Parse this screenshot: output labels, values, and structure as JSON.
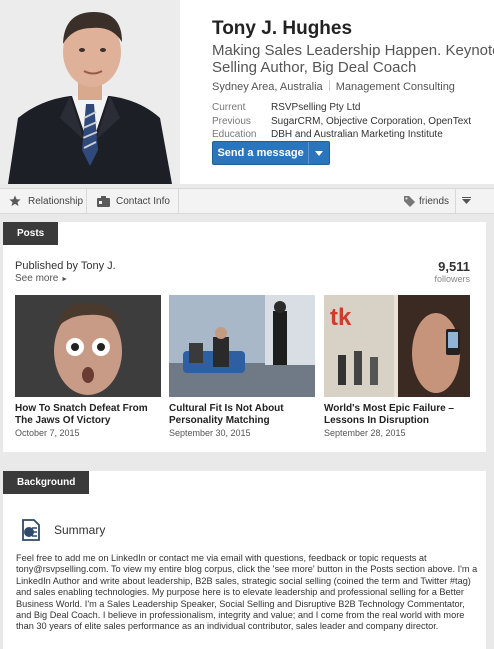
{
  "profile": {
    "name": "Tony J. Hughes",
    "headline_line1": "Making Sales Leadership Happen. Keynote Speaker,",
    "headline_line2": "Selling Author, Big Deal Coach",
    "location": "Sydney Area, Australia",
    "industry": "Management Consulting",
    "current_label": "Current",
    "current_value": "RSVPselling Pty Ltd",
    "previous_label": "Previous",
    "previous_value": "SugarCRM, Objective Corporation, OpenText",
    "education_label": "Education",
    "education_value": "DBH and Australian Marketing Institute",
    "message_button": "Send a message"
  },
  "relationship_bar": {
    "relationship_label": "Relationship",
    "contact_label": "Contact Info",
    "friends_label": "friends"
  },
  "posts": {
    "section_label": "Posts",
    "published_by": "Published by Tony J.",
    "see_more": "See more",
    "followers_count": "9,511",
    "followers_label": "followers",
    "items": [
      {
        "title": "How To Snatch Defeat From The Jaws Of Victory",
        "date": "October 7, 2015"
      },
      {
        "title": "Cultural Fit Is Not About Personality Matching",
        "date": "September 30, 2015"
      },
      {
        "title": "World's Most Epic Failure – Lessons In Disruption",
        "date": "September 28, 2015"
      }
    ]
  },
  "background": {
    "section_label": "Background",
    "summary_title": "Summary",
    "summary_text": "Feel free to add me on LinkedIn or contact me via email with questions, feedback or topic requests at tony@rsvpselling.com. To view my entire blog corpus, click the 'see more' button in the Posts section above. I'm a LinkedIn Author and write about leadership, B2B sales, strategic social selling (coined the term and Twitter #tag) and sales enabling technologies. My purpose here is to elevate leadership and professional selling for a Better Business World. I'm a Sales Leadership Speaker, Social Selling and Disruptive B2B Technology Commentator, and Big Deal Coach. I believe in professionalism, integrity and value; and I come from the real world with more than 30 years of elite sales performance as an individual contributor, sales leader and company director."
  },
  "icons": {
    "star": "star-icon",
    "contact": "contact-card-icon",
    "tag": "tag-icon",
    "caret": "chevron-down-icon",
    "summary": "summary-document-icon"
  },
  "colors": {
    "primary_button": "#2b75bd",
    "section_header": "#3a3a3a",
    "page_background": "#e9e9e9"
  }
}
